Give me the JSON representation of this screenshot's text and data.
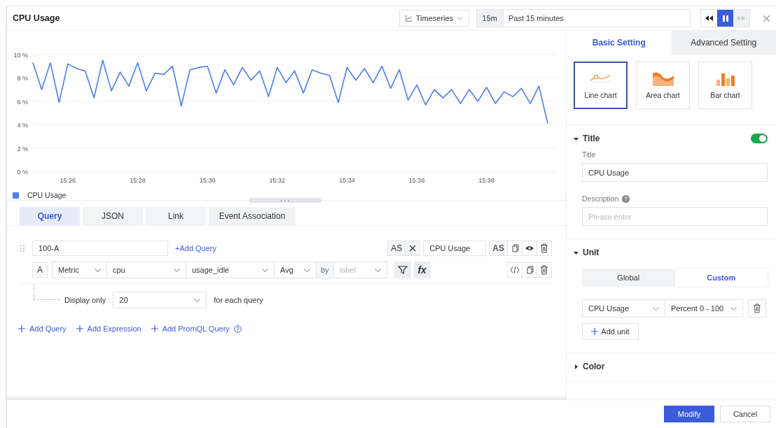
{
  "header": {
    "title": "CPU Usage",
    "view_select": "Timeseries",
    "range_short": "15m",
    "range_label": "Past 15 minutes",
    "playback": [
      {
        "kind": "rewind",
        "selected": false,
        "disabled": false
      },
      {
        "kind": "pause",
        "selected": true,
        "disabled": false
      },
      {
        "kind": "forward",
        "selected": false,
        "disabled": true
      }
    ]
  },
  "chart": {
    "chart_data": {
      "type": "line",
      "grid": true,
      "ylim": [
        0,
        10
      ],
      "yticks": [
        {
          "value": 0,
          "label": "0 %"
        },
        {
          "value": 2,
          "label": "2 %"
        },
        {
          "value": 4,
          "label": "4 %"
        },
        {
          "value": 6,
          "label": "6 %"
        },
        {
          "value": 8,
          "label": "8 %"
        },
        {
          "value": 10,
          "label": "10 %"
        }
      ],
      "categories": [
        null,
        null,
        null,
        null,
        "15:26",
        null,
        null,
        null,
        null,
        null,
        null,
        null,
        "15:28",
        null,
        null,
        null,
        null,
        null,
        null,
        null,
        "15:30",
        null,
        null,
        null,
        null,
        null,
        null,
        null,
        "15:32",
        null,
        null,
        null,
        null,
        null,
        null,
        null,
        "15:34",
        null,
        null,
        null,
        null,
        null,
        null,
        null,
        "15:36",
        null,
        null,
        null,
        null,
        null,
        null,
        null,
        "15:38",
        null,
        null,
        null,
        null,
        null,
        null,
        null
      ],
      "series": [
        {
          "name": "CPU Usage",
          "color": "#4b7ef0",
          "values": [
            9.3,
            7.0,
            9.3,
            5.9,
            9.2,
            8.8,
            8.6,
            6.3,
            9.5,
            6.9,
            8.5,
            7.3,
            9.3,
            6.9,
            8.4,
            8.3,
            9.0,
            5.6,
            8.7,
            8.9,
            9.0,
            6.7,
            8.7,
            7.4,
            8.9,
            7.8,
            8.6,
            6.4,
            8.9,
            7.6,
            8.6,
            6.7,
            8.7,
            8.4,
            8.2,
            5.9,
            8.9,
            7.8,
            8.8,
            7.6,
            9.0,
            7.1,
            8.7,
            6.1,
            7.4,
            5.7,
            7.0,
            6.3,
            7.0,
            5.8,
            7.0,
            6.0,
            7.2,
            5.8,
            6.8,
            6.4,
            7.1,
            5.8,
            7.3,
            4.1
          ]
        }
      ]
    }
  },
  "query_tabs": [
    {
      "label": "Query",
      "selected": true
    },
    {
      "label": "JSON",
      "selected": false
    },
    {
      "label": "Link",
      "selected": false
    },
    {
      "label": "Event Association",
      "selected": false
    }
  ],
  "query": {
    "name": "100-A",
    "add_query": "+Add Query",
    "alias_prefix": "AS",
    "alias": "CPU Usage",
    "alias_label": "AS",
    "letter": "A",
    "source": "Metric",
    "metric": "cpu",
    "field": "usage_idle",
    "aggregation": "Avg",
    "by": "by",
    "label_placeholder": "label",
    "fx": "fx"
  },
  "display": {
    "prefix": "Display only",
    "value": "20",
    "suffix": "for each query"
  },
  "add_links": [
    "Add Query",
    "Add Expression",
    "Add PromQL Query"
  ],
  "settings": {
    "tabs": [
      {
        "label": "Basic Setting",
        "selected": true
      },
      {
        "label": "Advanced Setting",
        "selected": false
      }
    ],
    "chart_types": [
      {
        "kind": "line",
        "label": "Line chart",
        "selected": true
      },
      {
        "kind": "area",
        "label": "Area chart",
        "selected": false
      },
      {
        "kind": "bar",
        "label": "Bar chart",
        "selected": false
      }
    ],
    "title_section": {
      "heading": "Title",
      "expanded": true,
      "on": true,
      "title_label": "Title",
      "title_value": "CPU Usage",
      "description_label": "Description",
      "description_placeholder": "Please enter"
    },
    "unit_section": {
      "heading": "Unit",
      "expanded": true,
      "modes": [
        {
          "label": "Global",
          "selected": false
        },
        {
          "label": "Custom",
          "selected": true
        }
      ],
      "unit_name": "CPU Usage",
      "unit_value": "Percent 0 - 100",
      "add_unit": "Add unit"
    },
    "color_section": {
      "heading": "Color",
      "expanded": false
    }
  },
  "footer": {
    "buttons": [
      {
        "label": "Modify",
        "kind": "primary"
      },
      {
        "label": "Cancel",
        "kind": "default"
      }
    ]
  }
}
